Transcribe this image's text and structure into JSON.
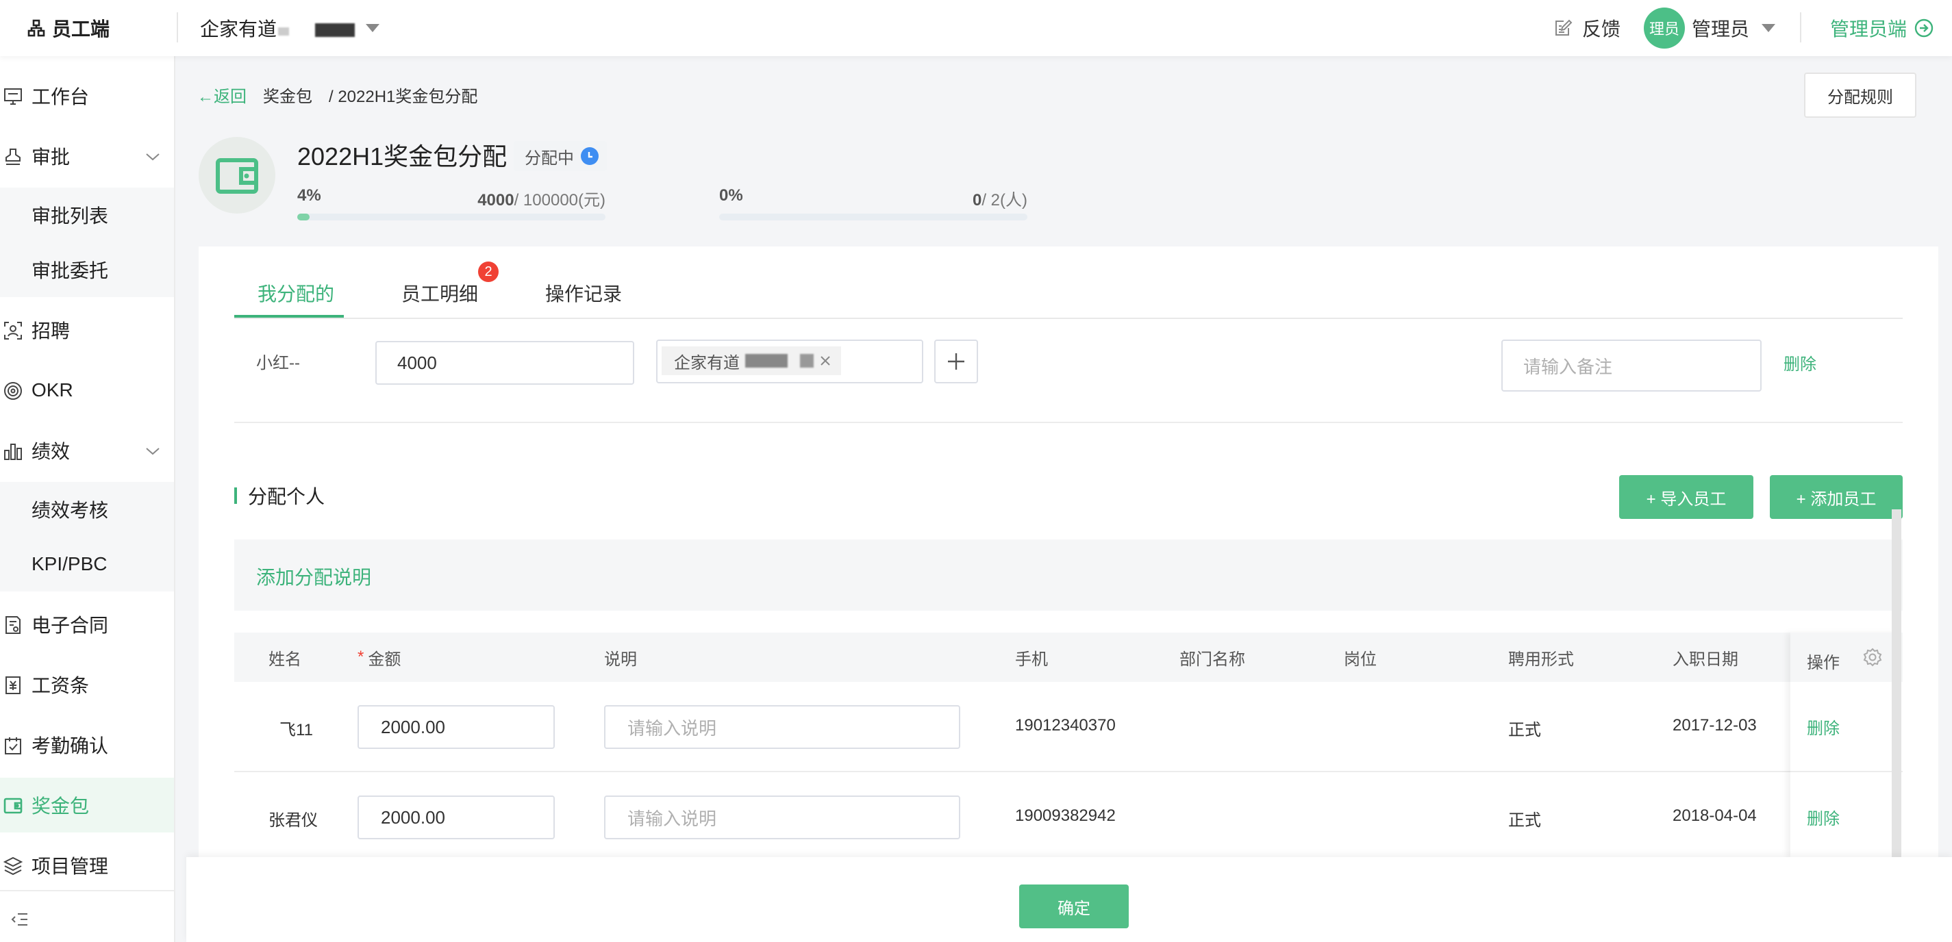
{
  "header": {
    "brand": "员工端",
    "company": "企家有道",
    "feedback": "反馈",
    "avatar_text": "理员",
    "user_name": "管理员",
    "admin_switch": "管理员端"
  },
  "sidebar": {
    "items": [
      {
        "label": "工作台",
        "icon": "monitor-icon"
      },
      {
        "label": "审批",
        "icon": "stamp-icon"
      },
      {
        "label": "审批列表"
      },
      {
        "label": "审批委托"
      },
      {
        "label": "招聘",
        "icon": "scan-user-icon"
      },
      {
        "label": "OKR",
        "icon": "target-icon"
      },
      {
        "label": "绩效",
        "icon": "bar-chart-icon"
      },
      {
        "label": "绩效考核"
      },
      {
        "label": "KPI/PBC"
      },
      {
        "label": "电子合同",
        "icon": "contract-icon"
      },
      {
        "label": "工资条",
        "icon": "payslip-icon"
      },
      {
        "label": "考勤确认",
        "icon": "calendar-check-icon"
      },
      {
        "label": "奖金包",
        "icon": "wallet-icon",
        "active": true
      },
      {
        "label": "项目管理",
        "icon": "layers-icon"
      }
    ]
  },
  "breadcrumb": {
    "back": "←返回",
    "parent": "奖金包",
    "current": "/ 2022H1奖金包分配"
  },
  "rules_button": "分配规则",
  "page": {
    "title": "2022H1奖金包分配",
    "status": "分配中",
    "amount_progress": {
      "percent": "4%",
      "value": "4000",
      "total": "/ 100000(元)",
      "fraction": 0.04
    },
    "people_progress": {
      "percent": "0%",
      "value": "0",
      "total": "/ 2(人)",
      "fraction": 0.0
    }
  },
  "tabs": [
    {
      "label": "我分配的",
      "active": true
    },
    {
      "label": "员工明细",
      "badge": "2"
    },
    {
      "label": "操作记录"
    }
  ],
  "allocation": {
    "name": "小红--",
    "amount": "4000",
    "company_tag": "企家有道",
    "remark_placeholder": "请输入备注",
    "delete": "删除"
  },
  "section": {
    "title": "分配个人",
    "import_button": "+ 导入员工",
    "add_button": "+ 添加员工",
    "note_link": "添加分配说明"
  },
  "table": {
    "columns": {
      "name": "姓名",
      "amount": "金额",
      "desc": "说明",
      "phone": "手机",
      "dept": "部门名称",
      "post": "岗位",
      "type": "聘用形式",
      "date": "入职日期",
      "ops": "操作"
    },
    "rows": [
      {
        "name": "飞11",
        "amount": "2000.00",
        "desc_placeholder": "请输入说明",
        "phone": "19012340370",
        "dept": "",
        "post": "",
        "type": "正式",
        "date": "2017-12-03",
        "op": "删除"
      },
      {
        "name": "张君仪",
        "amount": "2000.00",
        "desc_placeholder": "请输入说明",
        "phone": "19009382942",
        "dept": "",
        "post": "",
        "type": "正式",
        "date": "2018-04-04",
        "op": "删除"
      }
    ]
  },
  "footer": {
    "confirm": "确定"
  },
  "colors": {
    "accent": "#3db37b",
    "button": "#52bf87",
    "badge": "#f04134",
    "status_dot": "#3f8ef2"
  }
}
